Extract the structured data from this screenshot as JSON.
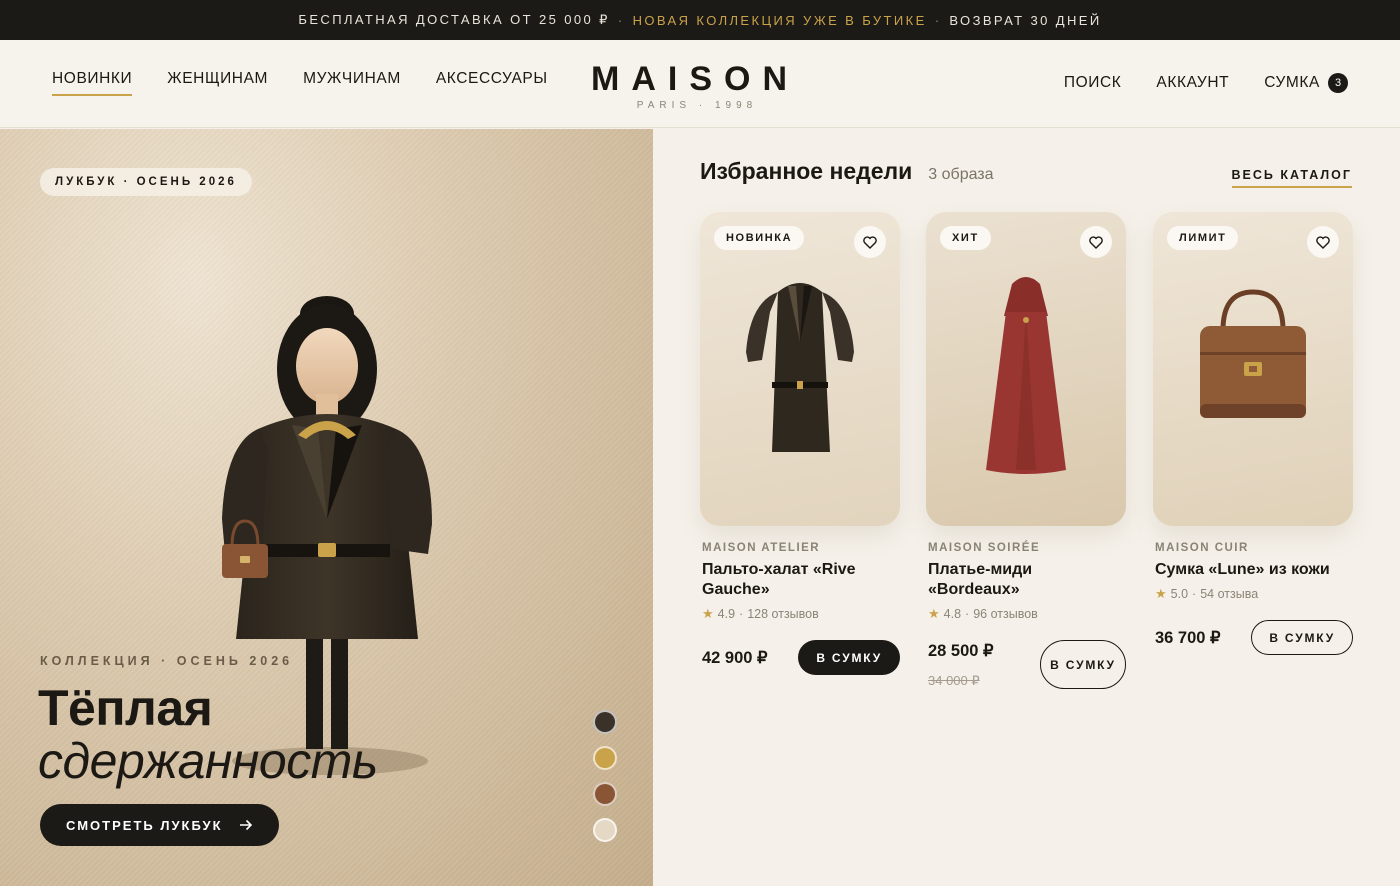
{
  "promo": {
    "left": "БЕСПЛАТНАЯ ДОСТАВКА ОТ 25 000 ₽",
    "middle": "НОВАЯ КОЛЛЕКЦИЯ УЖЕ В БУТИКЕ",
    "right": "ВОЗВРАТ 30 ДНЕЙ",
    "separator": "·"
  },
  "nav": {
    "left": [
      "НОВИНКИ",
      "ЖЕНЩИНАМ",
      "МУЖЧИНАМ",
      "АКСЕССУАРЫ"
    ],
    "right": [
      "ПОИСК",
      "АККАУНТ",
      "СУМКА"
    ],
    "bag_count": "3"
  },
  "logo": {
    "name": "MAISON",
    "tagline": "PARIS · 1998"
  },
  "hero": {
    "pill": "ЛУКБУК · ОСЕНЬ 2026",
    "eyebrow": "КОЛЛЕКЦИЯ · ОСЕНЬ 2026",
    "title_line1": "Тёплая",
    "title_line2": "сдержанность",
    "cta": "СМОТРЕТЬ ЛУКБУК",
    "cta_icon": "arrow-right-icon",
    "swatches": [
      "#3a3228",
      "#c9a24a",
      "#8a5535",
      "#e5d9c5"
    ]
  },
  "featured": {
    "title": "Избранное недели",
    "count": "3 образа",
    "catalog_link": "ВЕСЬ КАТАЛОГ"
  },
  "products": [
    {
      "badge": "НОВИНКА",
      "brand": "MAISON ATELIER",
      "name": "Пальто-халат «Rive Gauche»",
      "rating": "4.9",
      "reviews": "128 отзывов",
      "price": "42 900 ₽",
      "old_price": "",
      "button": "В СУМКУ",
      "button_style": "dark"
    },
    {
      "badge": "ХИТ",
      "brand": "MAISON SOIRÉE",
      "name": "Платье-миди «Bordeaux»",
      "rating": "4.8",
      "reviews": "96 отзывов",
      "price": "28 500 ₽",
      "old_price": "34 000 ₽",
      "button": "В СУМКУ",
      "button_style": "outline"
    },
    {
      "badge": "ЛИМИТ",
      "brand": "MAISON CUIR",
      "name": "Сумка «Lune» из кожи",
      "rating": "5.0",
      "reviews": "54 отзыва",
      "price": "36 700 ₽",
      "old_price": "",
      "button": "В СУМКУ",
      "button_style": "outline"
    }
  ],
  "colors": {
    "accent": "#c9a24a",
    "dark": "#1c1a16",
    "background": "#f5f1ea"
  }
}
